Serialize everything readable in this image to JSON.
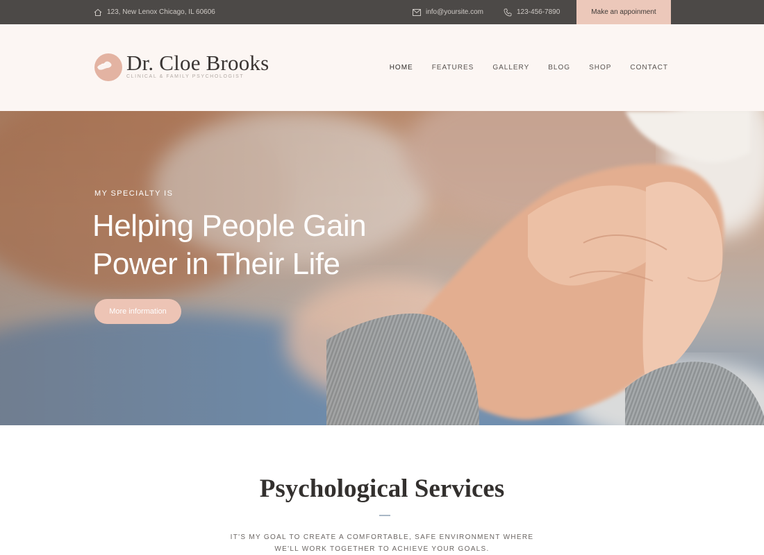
{
  "topbar": {
    "address": "123, New Lenox Chicago, IL 60606",
    "email": "info@yoursite.com",
    "phone": "123-456-7890",
    "cta_label": "Make an appoinment",
    "icons": [
      "home-icon",
      "mail-icon",
      "phone-icon"
    ]
  },
  "header": {
    "logo_title": "Dr. Cloe Brooks",
    "logo_subtitle": "CLINICAL & FAMILY PSYCHOLOGIST",
    "nav": [
      {
        "label": "HOME",
        "active": true
      },
      {
        "label": "FEATURES",
        "active": false
      },
      {
        "label": "GALLERY",
        "active": false
      },
      {
        "label": "BLOG",
        "active": false
      },
      {
        "label": "SHOP",
        "active": false
      },
      {
        "label": "CONTACT",
        "active": false
      }
    ]
  },
  "hero": {
    "kicker": "MY SPECIALTY IS",
    "title_line1": "Helping People Gain",
    "title_line2": "Power in Their Life",
    "button_label": "More information"
  },
  "services": {
    "title": "Psychological Services",
    "desc_line1": "IT'S MY GOAL TO CREATE A COMFORTABLE, SAFE ENVIRONMENT WHERE",
    "desc_line2": "WE'LL WORK TOGETHER TO ACHIEVE YOUR GOALS."
  },
  "colors": {
    "topbar_bg": "#4c4947",
    "accent": "#ecc8ba",
    "header_bg": "#fcf6f3"
  }
}
